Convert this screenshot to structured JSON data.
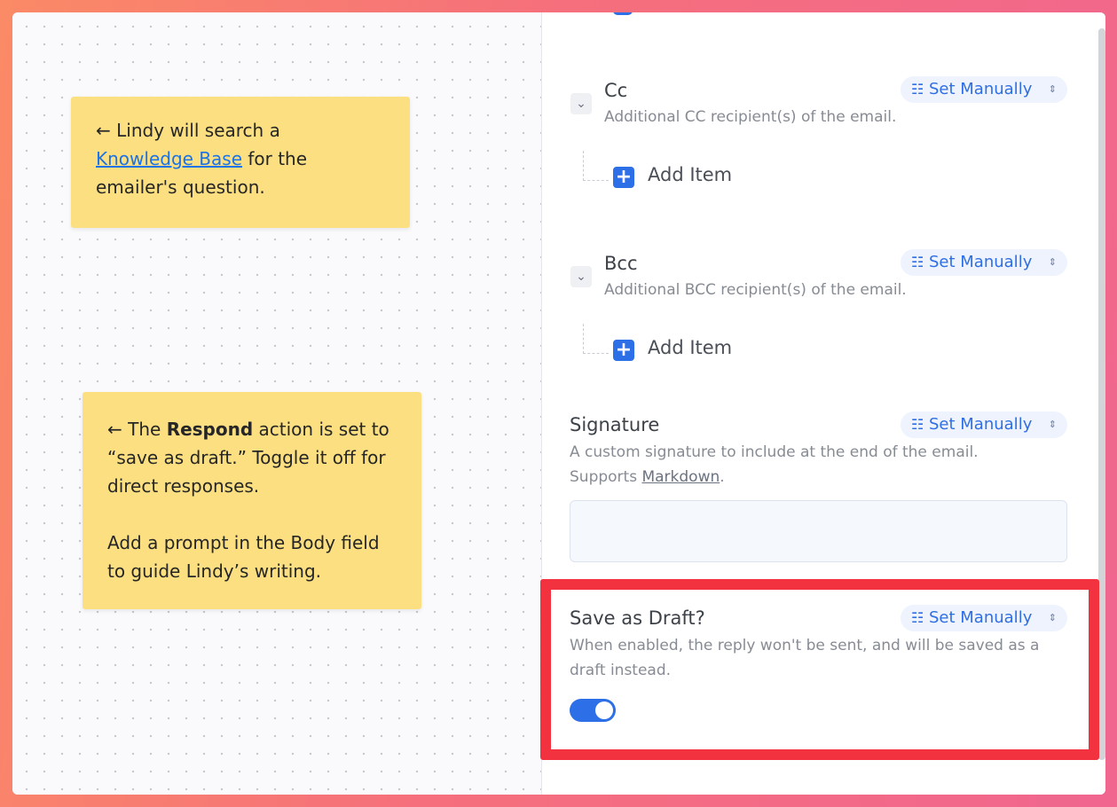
{
  "notes": {
    "knowledge": {
      "arrow": "←",
      "pre": " Lindy will search a",
      "link": "Knowledge Base",
      "post": " for the emailer's question."
    },
    "respond": {
      "arrow": "←",
      "pre": " The ",
      "bold": "Respond",
      "post": " action is set to “save as draft.” Toggle it off for direct responses.",
      "para2": "Add a prompt in the Body field to guide Lindy’s writing."
    }
  },
  "panel": {
    "set_label": "Set Manually",
    "cc": {
      "title": "Cc",
      "description": "Additional CC recipient(s) of the email.",
      "add_label": "Add Item"
    },
    "bcc": {
      "title": "Bcc",
      "description": "Additional BCC recipient(s) of the email.",
      "add_label": "Add Item"
    },
    "signature": {
      "title": "Signature",
      "description": "A custom signature to include at the end of the email.",
      "supports": "Supports ",
      "markdown_link": "Markdown",
      "period": ".",
      "value": ""
    },
    "draft": {
      "title": "Save as Draft?",
      "description": "When enabled, the reply won't be sent, and will be saved as a draft instead.",
      "enabled": true
    }
  },
  "colors": {
    "accent": "#2d6fe6",
    "highlight": "#f2333f",
    "note": "#fbdf80"
  },
  "icons": [
    "chevron-down-icon",
    "plus-icon",
    "set-manually-icon",
    "up-down-icon"
  ]
}
